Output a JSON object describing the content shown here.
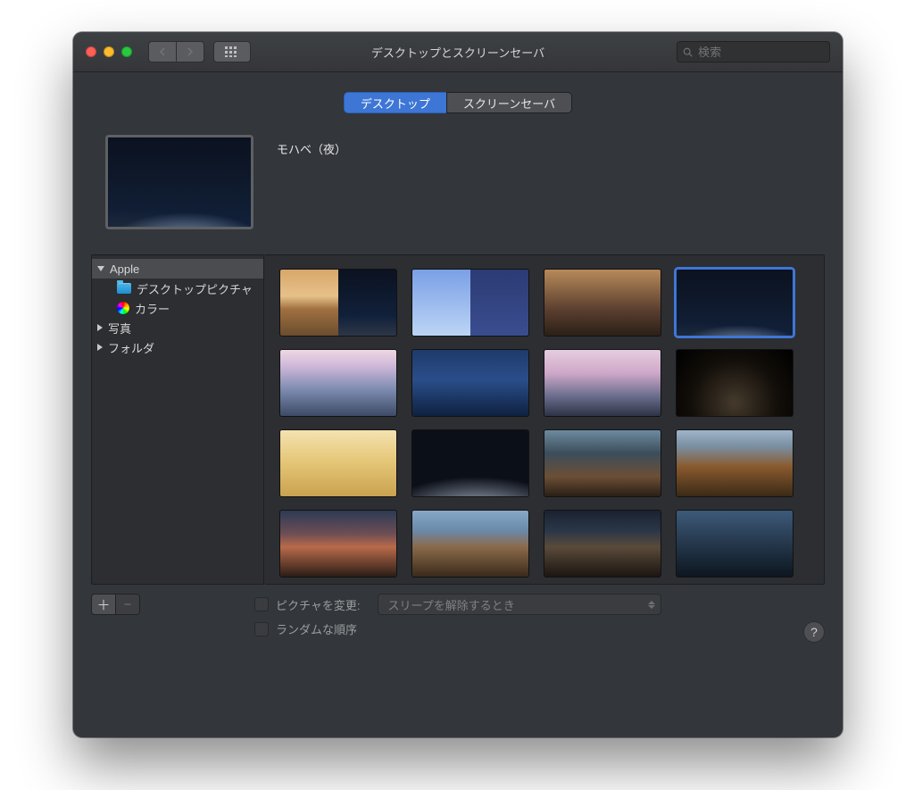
{
  "window": {
    "title": "デスクトップとスクリーンセーバ"
  },
  "search": {
    "placeholder": "検索"
  },
  "tabs": {
    "desktop": "デスクトップ",
    "screensaver": "スクリーンセーバ"
  },
  "current_wallpaper": {
    "name": "モハベ（夜）"
  },
  "sidebar": {
    "apple": "Apple",
    "desktop_pictures": "デスクトップピクチャ",
    "colors": "カラー",
    "photos": "写真",
    "folders": "フォルダ"
  },
  "thumbnails": [
    {
      "id": "mojave-dynamic",
      "selected": false
    },
    {
      "id": "gradient-dynamic",
      "selected": false
    },
    {
      "id": "mojave-day",
      "selected": false
    },
    {
      "id": "mojave-night",
      "selected": true
    },
    {
      "id": "desert-dawn",
      "selected": false
    },
    {
      "id": "lake-blue",
      "selected": false
    },
    {
      "id": "mono-tufa",
      "selected": false
    },
    {
      "id": "night-trees",
      "selected": false
    },
    {
      "id": "dunes-light",
      "selected": false
    },
    {
      "id": "dune-dark",
      "selected": false
    },
    {
      "id": "rock-spires",
      "selected": false
    },
    {
      "id": "autumn-mountain",
      "selected": false
    },
    {
      "id": "sierra-sunrise",
      "selected": false
    },
    {
      "id": "sierra-day",
      "selected": false
    },
    {
      "id": "elcap-dusk",
      "selected": false
    },
    {
      "id": "yosemite-blue",
      "selected": false
    }
  ],
  "controls": {
    "add": "＋",
    "remove": "−",
    "change_picture_label": "ピクチャを変更:",
    "change_picture_option": "スリープを解除するとき",
    "random_order_label": "ランダムな順序",
    "help": "?"
  }
}
